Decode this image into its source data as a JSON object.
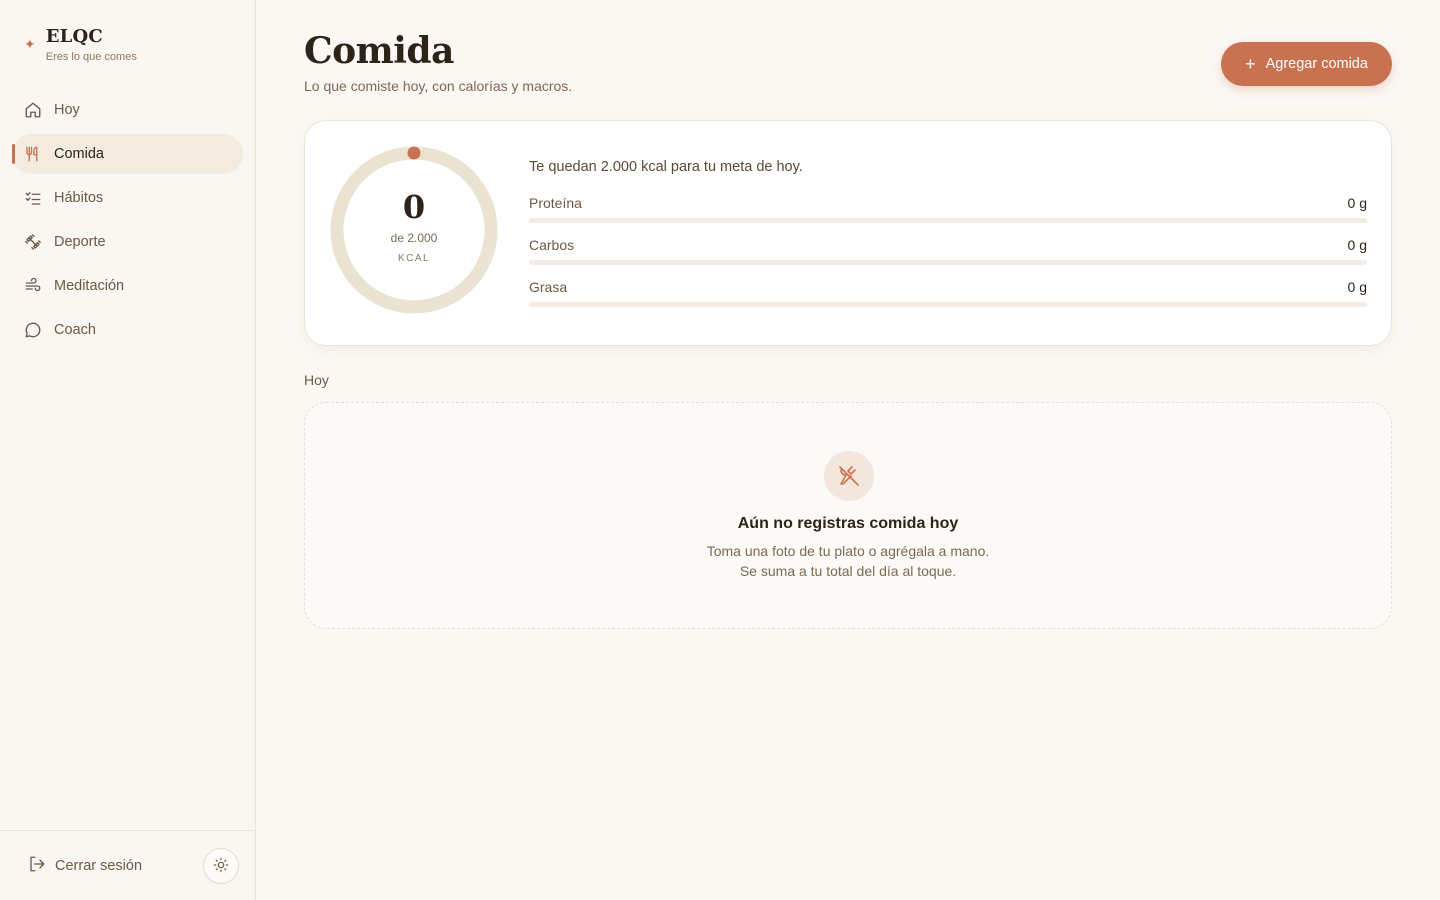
{
  "brand": {
    "name": "ELQC",
    "tagline": "Eres lo que comes",
    "icon": "sparkle-icon"
  },
  "sidebar": {
    "items": [
      {
        "label": "Hoy",
        "icon": "home-icon",
        "active": false
      },
      {
        "label": "Comida",
        "icon": "utensils-icon",
        "active": true
      },
      {
        "label": "Hábitos",
        "icon": "checklist-icon",
        "active": false
      },
      {
        "label": "Deporte",
        "icon": "dumbbell-icon",
        "active": false
      },
      {
        "label": "Meditación",
        "icon": "wind-icon",
        "active": false
      },
      {
        "label": "Coach",
        "icon": "chat-icon",
        "active": false
      }
    ],
    "logout_label": "Cerrar sesión",
    "theme_toggle_icon": "sun-icon"
  },
  "header": {
    "title": "Comida",
    "subtitle": "Lo que comiste hoy, con calorías y macros.",
    "add_button_label": "Agregar comida"
  },
  "summary": {
    "kcal_consumed": "0",
    "kcal_goal_label": "de 2.000",
    "kcal_unit": "KCAL",
    "progress_fraction": 0,
    "remaining_text": "Te quedan 2.000 kcal para tu meta de hoy.",
    "macros": [
      {
        "name": "Proteína",
        "value": "0 g",
        "fraction": 0
      },
      {
        "name": "Carbos",
        "value": "0 g",
        "fraction": 0
      },
      {
        "name": "Grasa",
        "value": "0 g",
        "fraction": 0
      }
    ]
  },
  "today_section": {
    "label": "Hoy",
    "empty_icon": "no-food-icon",
    "empty_title": "Aún no registras comida hoy",
    "empty_line1": "Toma una foto de tu plato o agrégala a mano.",
    "empty_line2": "Se suma a tu total del día al toque."
  },
  "colors": {
    "accent": "#c87252",
    "background": "#fbf8f4",
    "ring_track": "#ebe3d2"
  }
}
